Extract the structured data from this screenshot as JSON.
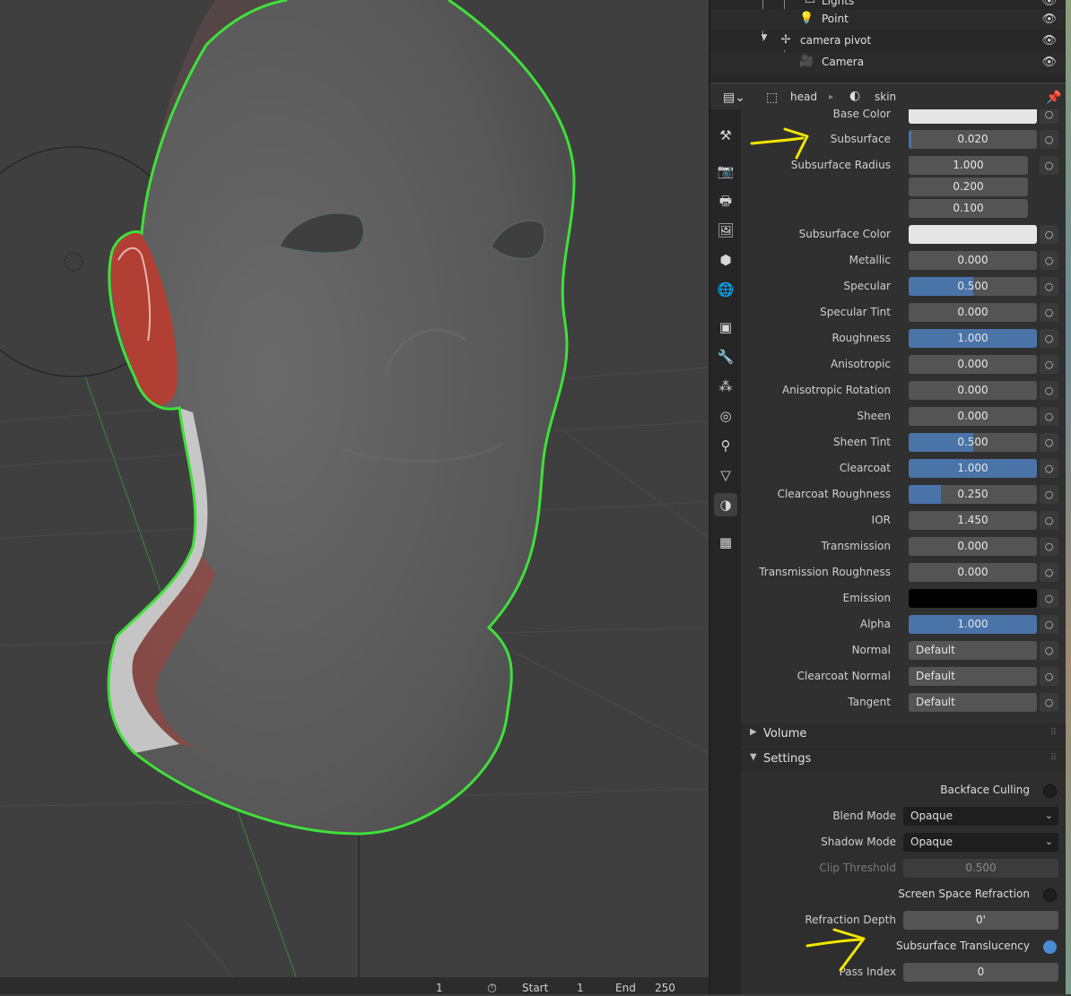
{
  "outliner": {
    "rows": [
      {
        "label": "Lights",
        "icon": "collection-icon"
      },
      {
        "label": "Point",
        "icon": "light-bulb-icon"
      },
      {
        "label": "camera pivot",
        "icon": "empty-axes-icon"
      },
      {
        "label": "Camera",
        "icon": "camera-icon"
      }
    ]
  },
  "properties_header": {
    "object": "head",
    "material": "skin"
  },
  "bsdf": {
    "base_color": {
      "label": "Base Color"
    },
    "subsurface": {
      "label": "Subsurface",
      "value": "0.020",
      "fraction": 0.02
    },
    "subsurface_radius": {
      "label": "Subsurface Radius",
      "values": [
        "1.000",
        "0.200",
        "0.100"
      ]
    },
    "subsurface_color": {
      "label": "Subsurface Color"
    },
    "metallic": {
      "label": "Metallic",
      "value": "0.000",
      "fraction": 0
    },
    "specular": {
      "label": "Specular",
      "value": "0.500",
      "fraction": 0.5
    },
    "specular_tint": {
      "label": "Specular Tint",
      "value": "0.000",
      "fraction": 0
    },
    "roughness": {
      "label": "Roughness",
      "value": "1.000",
      "fraction": 1
    },
    "anisotropic": {
      "label": "Anisotropic",
      "value": "0.000",
      "fraction": 0
    },
    "anisotropic_rotation": {
      "label": "Anisotropic Rotation",
      "value": "0.000",
      "fraction": 0
    },
    "sheen": {
      "label": "Sheen",
      "value": "0.000",
      "fraction": 0
    },
    "sheen_tint": {
      "label": "Sheen Tint",
      "value": "0.500",
      "fraction": 0.5
    },
    "clearcoat": {
      "label": "Clearcoat",
      "value": "1.000",
      "fraction": 1
    },
    "clearcoat_roughness": {
      "label": "Clearcoat Roughness",
      "value": "0.250",
      "fraction": 0.25
    },
    "ior": {
      "label": "IOR",
      "value": "1.450"
    },
    "transmission": {
      "label": "Transmission",
      "value": "0.000",
      "fraction": 0
    },
    "transmission_roughness": {
      "label": "Transmission Roughness",
      "value": "0.000",
      "fraction": 0
    },
    "emission": {
      "label": "Emission"
    },
    "alpha": {
      "label": "Alpha",
      "value": "1.000",
      "fraction": 1
    },
    "normal": {
      "label": "Normal",
      "value": "Default"
    },
    "clearcoat_normal": {
      "label": "Clearcoat Normal",
      "value": "Default"
    },
    "tangent": {
      "label": "Tangent",
      "value": "Default"
    }
  },
  "sections": {
    "volume": "Volume",
    "settings": "Settings"
  },
  "settings": {
    "backface_culling": {
      "label": "Backface Culling",
      "checked": false
    },
    "blend_mode": {
      "label": "Blend Mode",
      "value": "Opaque"
    },
    "shadow_mode": {
      "label": "Shadow Mode",
      "value": "Opaque"
    },
    "clip_threshold": {
      "label": "Clip Threshold",
      "value": "0.500"
    },
    "screen_space_refraction": {
      "label": "Screen Space Refraction",
      "checked": false
    },
    "refraction_depth": {
      "label": "Refraction Depth",
      "value": "0'"
    },
    "subsurface_translucency": {
      "label": "Subsurface Translucency",
      "checked": true
    },
    "pass_index": {
      "label": "Pass Index",
      "value": "0"
    }
  },
  "statusbar": {
    "current_frame": "1",
    "start_label": "Start",
    "start_value": "1",
    "end_label": "End",
    "end_value": "250"
  },
  "colors": {
    "accent": "#4a73a7",
    "selection_outline": "#3fe03a",
    "annotation": "#f2e600"
  }
}
